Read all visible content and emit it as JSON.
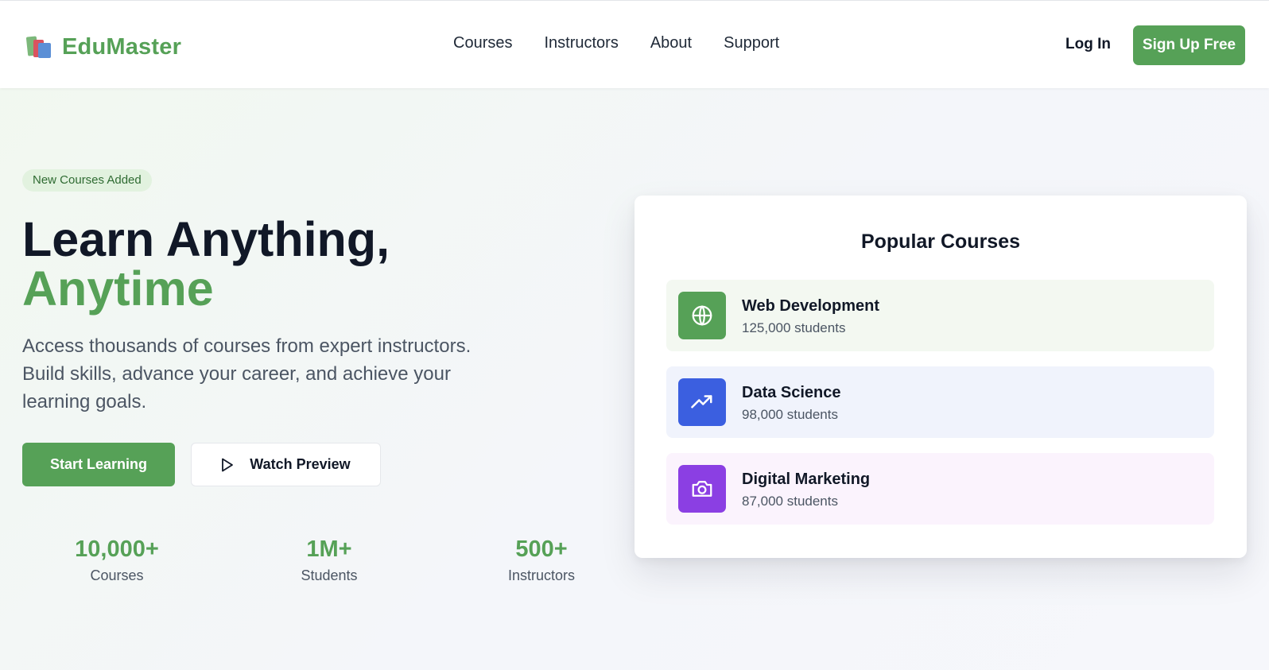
{
  "header": {
    "logo_text": "EduMaster",
    "nav": [
      "Courses",
      "Instructors",
      "About",
      "Support"
    ],
    "login_label": "Log In",
    "signup_label": "Sign Up Free"
  },
  "hero": {
    "badge": "New Courses Added",
    "headline_line1": "Learn Anything,",
    "headline_line2": "Anytime",
    "description": "Access thousands of courses from expert instructors. Build skills, advance your career, and achieve your learning goals.",
    "primary_button": "Start Learning",
    "secondary_button": "Watch Preview",
    "stats": [
      {
        "value": "10,000+",
        "label": "Courses"
      },
      {
        "value": "1M+",
        "label": "Students"
      },
      {
        "value": "500+",
        "label": "Instructors"
      }
    ]
  },
  "popular": {
    "title": "Popular Courses",
    "courses": [
      {
        "name": "Web Development",
        "students": "125,000 students",
        "icon": "globe-icon",
        "color": "#56a157",
        "bg": "#f3f8f1"
      },
      {
        "name": "Data Science",
        "students": "98,000 students",
        "icon": "trending-up-icon",
        "color": "#3b5fe0",
        "bg": "#f0f3fc"
      },
      {
        "name": "Digital Marketing",
        "students": "87,000 students",
        "icon": "camera-icon",
        "color": "#8b3fe3",
        "bg": "#fbf3fd"
      }
    ]
  },
  "colors": {
    "brand": "#56a157",
    "text": "#111827",
    "muted": "#4b5563"
  }
}
